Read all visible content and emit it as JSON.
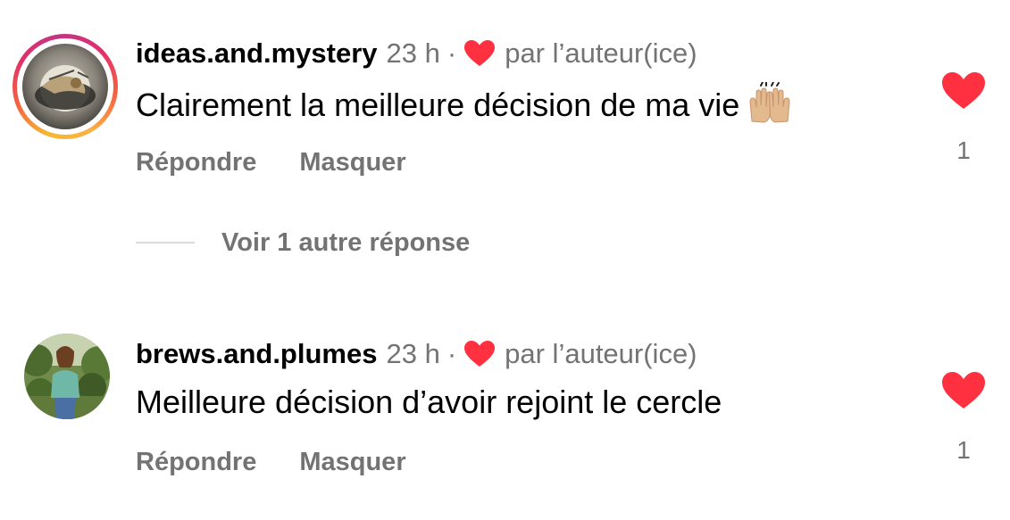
{
  "comments": [
    {
      "username": "ideas.and.mystery",
      "time": "23 h",
      "separator": "·",
      "author_like_label": "par l’auteur(ice)",
      "text": "Clairement la meilleure décision de ma vie",
      "emoji": "raising-hands-emoji",
      "reply_label": "Répondre",
      "hide_label": "Masquer",
      "like_count": "1",
      "has_story_ring": true
    },
    {
      "username": "brews.and.plumes",
      "time": "23 h",
      "separator": "·",
      "author_like_label": "par l’auteur(ice)",
      "text": "Meilleure décision d’avoir rejoint le cercle",
      "reply_label": "Répondre",
      "hide_label": "Masquer",
      "like_count": "1",
      "has_story_ring": false
    }
  ],
  "view_replies_label": "Voir 1 autre réponse",
  "colors": {
    "heart": "#ff3040",
    "muted_text": "#737373",
    "primary_text": "#000000",
    "divider": "#dbdbdb"
  },
  "icons": {
    "author_like": "heart-icon",
    "like": "heart-icon",
    "emoji": "raising-hands-icon"
  }
}
